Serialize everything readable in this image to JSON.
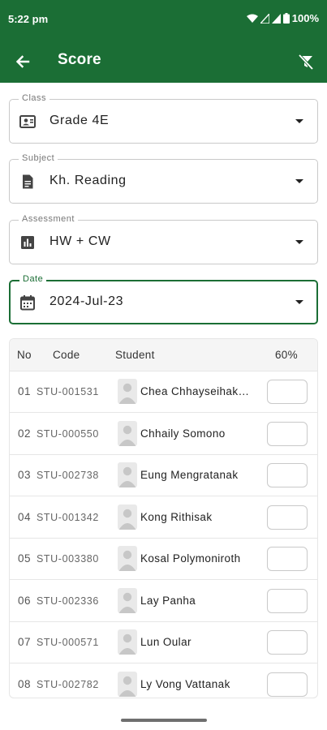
{
  "status_bar": {
    "time": "5:22 pm",
    "battery": "100%",
    "icons": [
      "wifi-icon",
      "signal-icon",
      "signal-icon",
      "battery-icon"
    ]
  },
  "app_bar": {
    "title": "Score",
    "back_icon": "arrow-left-icon",
    "action_icon": "filter-off-icon"
  },
  "filters": {
    "class": {
      "label": "Class",
      "value": "Grade 4E",
      "icon": "class-contact-icon"
    },
    "subject": {
      "label": "Subject",
      "value": "Kh. Reading",
      "icon": "document-icon"
    },
    "assessment": {
      "label": "Assessment",
      "value": "HW + CW",
      "icon": "bar-chart-icon"
    },
    "date": {
      "label": "Date",
      "value": "2024-Jul-23",
      "icon": "calendar-icon"
    }
  },
  "table": {
    "headers": {
      "no": "No",
      "code": "Code",
      "student": "Student",
      "score": "60%"
    },
    "rows": [
      {
        "no": "01",
        "code": "STU-001531",
        "name": "Chea Chhayseihak…",
        "score": ""
      },
      {
        "no": "02",
        "code": "STU-000550",
        "name": "Chhaily Somono",
        "score": ""
      },
      {
        "no": "03",
        "code": "STU-002738",
        "name": "Eung Mengratanak",
        "score": ""
      },
      {
        "no": "04",
        "code": "STU-001342",
        "name": "Kong Rithisak",
        "score": ""
      },
      {
        "no": "05",
        "code": "STU-003380",
        "name": "Kosal Polymoniroth",
        "score": ""
      },
      {
        "no": "06",
        "code": "STU-002336",
        "name": "Lay Panha",
        "score": ""
      },
      {
        "no": "07",
        "code": "STU-000571",
        "name": "Lun Oular",
        "score": ""
      },
      {
        "no": "08",
        "code": "STU-002782",
        "name": "Ly Vong Vattanak",
        "score": ""
      }
    ]
  },
  "colors": {
    "primary": "#1b6e35",
    "border": "#c9c9c9",
    "header_bg": "#f5f5f5"
  }
}
